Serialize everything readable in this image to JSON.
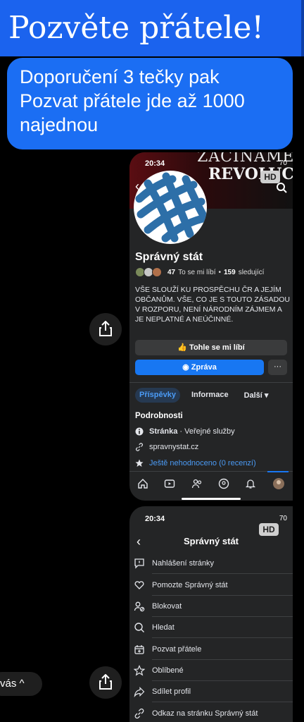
{
  "header": {
    "title": "Pozvěte přátele!"
  },
  "bubble": {
    "text": "Doporučení 3 tečky pak Pozvat přátele jde až 1000 najednou"
  },
  "phone1": {
    "time": "20:34",
    "battery": "70",
    "hd": "HD",
    "cover_line1": "ZAČÍNÁME",
    "cover_line2": "REVOLUC",
    "page_name": "Správný stát",
    "likes_count": "47",
    "likes_label": "To se mi líbí",
    "sep": "•",
    "followers_count": "159",
    "followers_label": "sledující",
    "description": "VŠE SLOUŽÍ KU PROSPĚCHU ČR A JEJÍM OBČANŮM. VŠE, CO JE S TOUTO ZÁSADOU V ROZPORU, NENÍ NÁRODNÍM ZÁJMEM A JE NEPLATNÉ A NEÚČINNÉ.",
    "like_button": "Tohle se mi líbí",
    "message_button": "Zpráva",
    "more_button": "···",
    "tabs": [
      {
        "label": "Příspěvky",
        "active": true
      },
      {
        "label": "Informace",
        "active": false
      },
      {
        "label": "Další ▾",
        "active": false
      }
    ],
    "details_heading": "Podrobnosti",
    "detail_page_bold": "Stránka",
    "detail_page_rest": " · Veřejné služby",
    "detail_url": "spravnystat.cz",
    "detail_rating": "Ještě nehodnoceno (0 recenzí)",
    "nav_icons": [
      "home-icon",
      "video-icon",
      "friends-icon",
      "groups-icon",
      "bell-icon",
      "profile-icon"
    ]
  },
  "phone2": {
    "time": "20:34",
    "battery": "70",
    "hd": "HD",
    "title": "Správný stát",
    "menu": [
      {
        "label": "Nahlášení stránky",
        "icon": "report-icon"
      },
      {
        "label": "Pomozte Správný stát",
        "icon": "heart-hand-icon"
      },
      {
        "label": "Blokovat",
        "icon": "block-user-icon"
      },
      {
        "label": "Hledat",
        "icon": "search-icon"
      },
      {
        "label": "Pozvat přátele",
        "icon": "invite-icon"
      },
      {
        "label": "Oblíbené",
        "icon": "star-icon"
      },
      {
        "label": "Sdílet profil",
        "icon": "share-arrow-icon"
      },
      {
        "label": "Odkaz na stránku Správný stát",
        "icon": "link-icon"
      }
    ]
  },
  "bottom_left": {
    "text": "vás ^"
  },
  "colors": {
    "accent": "#1877f2",
    "bubble": "#1b6ef3",
    "header": "#1b63ee",
    "panel": "#242526"
  }
}
